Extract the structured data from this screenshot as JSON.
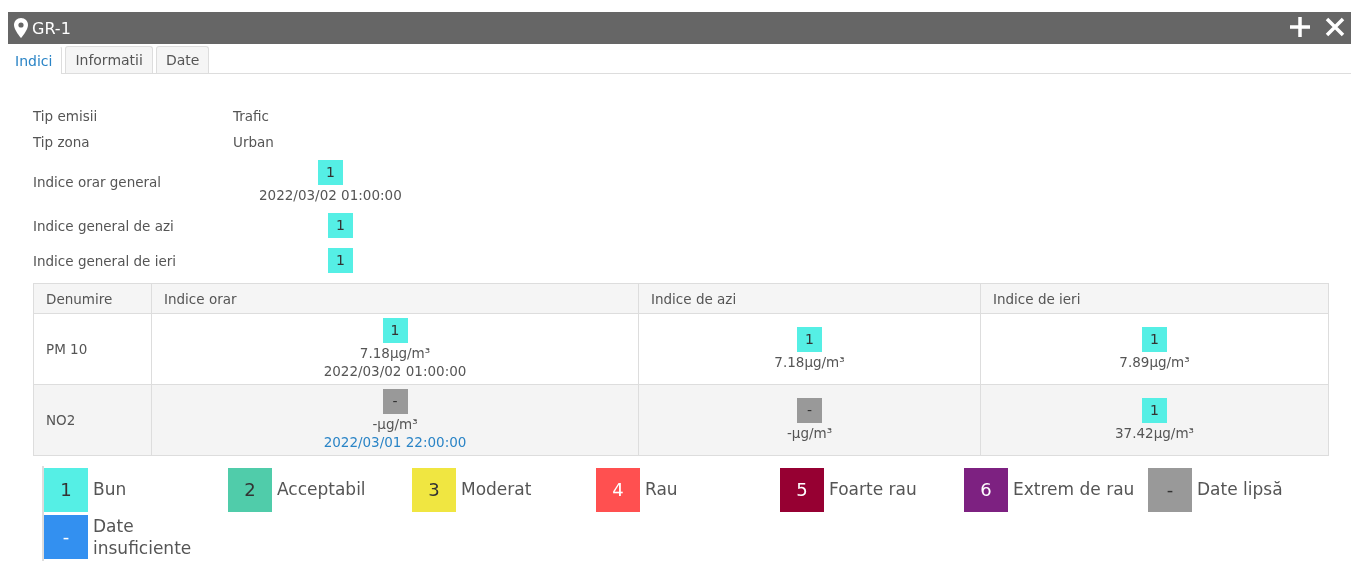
{
  "window": {
    "title": "GR-1"
  },
  "tabs": [
    {
      "label": "Indici",
      "selected": true
    },
    {
      "label": "Informatii",
      "selected": false
    },
    {
      "label": "Date",
      "selected": false
    }
  ],
  "info": [
    {
      "kind": "text",
      "label": "Tip emisii",
      "value": "Trafic"
    },
    {
      "kind": "text",
      "label": "Tip zona",
      "value": "Urban"
    },
    {
      "kind": "badge",
      "label": "Indice orar general",
      "badge": {
        "text": "1",
        "color": "#55efe5"
      },
      "time": "2022/03/02 01:00:00"
    },
    {
      "kind": "badge",
      "label": "Indice general de azi",
      "badge": {
        "text": "1",
        "color": "#55efe5"
      }
    },
    {
      "kind": "badge",
      "label": "Indice general de ieri",
      "badge": {
        "text": "1",
        "color": "#55efe5"
      }
    }
  ],
  "table": {
    "columns": [
      "Denumire",
      "Indice orar",
      "Indice de azi",
      "Indice de ieri"
    ],
    "rows": [
      {
        "cells": [
          {
            "kind": "name",
            "text": "PM 10"
          },
          {
            "kind": "index",
            "badge": {
              "text": "1",
              "color": "#55efe5"
            },
            "value": "7.18µg/m³",
            "time": "2022/03/02 01:00:00",
            "outdated": false
          },
          {
            "kind": "index",
            "badge": {
              "text": "1",
              "color": "#55efe5"
            },
            "value": "7.18µg/m³"
          },
          {
            "kind": "index",
            "badge": {
              "text": "1",
              "color": "#55efe5"
            },
            "value": "7.89µg/m³"
          }
        ]
      },
      {
        "cells": [
          {
            "kind": "name",
            "text": "NO2"
          },
          {
            "kind": "index",
            "badge": {
              "text": "-",
              "color": "#999999"
            },
            "value": "-µg/m³",
            "time": "2022/03/01 22:00:00",
            "outdated": true
          },
          {
            "kind": "index",
            "badge": {
              "text": "-",
              "color": "#999999"
            },
            "value": "-µg/m³"
          },
          {
            "kind": "index",
            "badge": {
              "text": "1",
              "color": "#55efe5"
            },
            "value": "37.42µg/m³"
          }
        ]
      }
    ]
  },
  "legend": [
    {
      "text": "1",
      "label": "Bun",
      "color": "#55efe5"
    },
    {
      "text": "2",
      "label": "Acceptabil",
      "color": "#50ccaa"
    },
    {
      "text": "3",
      "label": "Moderat",
      "color": "#f0e641"
    },
    {
      "text": "4",
      "label": "Rau",
      "color": "#ff5050"
    },
    {
      "text": "5",
      "label": "Foarte rau",
      "color": "#960032"
    },
    {
      "text": "6",
      "label": "Extrem de rau",
      "color": "#7d2181"
    },
    {
      "text": "-",
      "label": "Date lipsă",
      "color": "#999999"
    },
    {
      "text": "-",
      "label": "Date insuficiente",
      "color": "#3390f0"
    }
  ]
}
